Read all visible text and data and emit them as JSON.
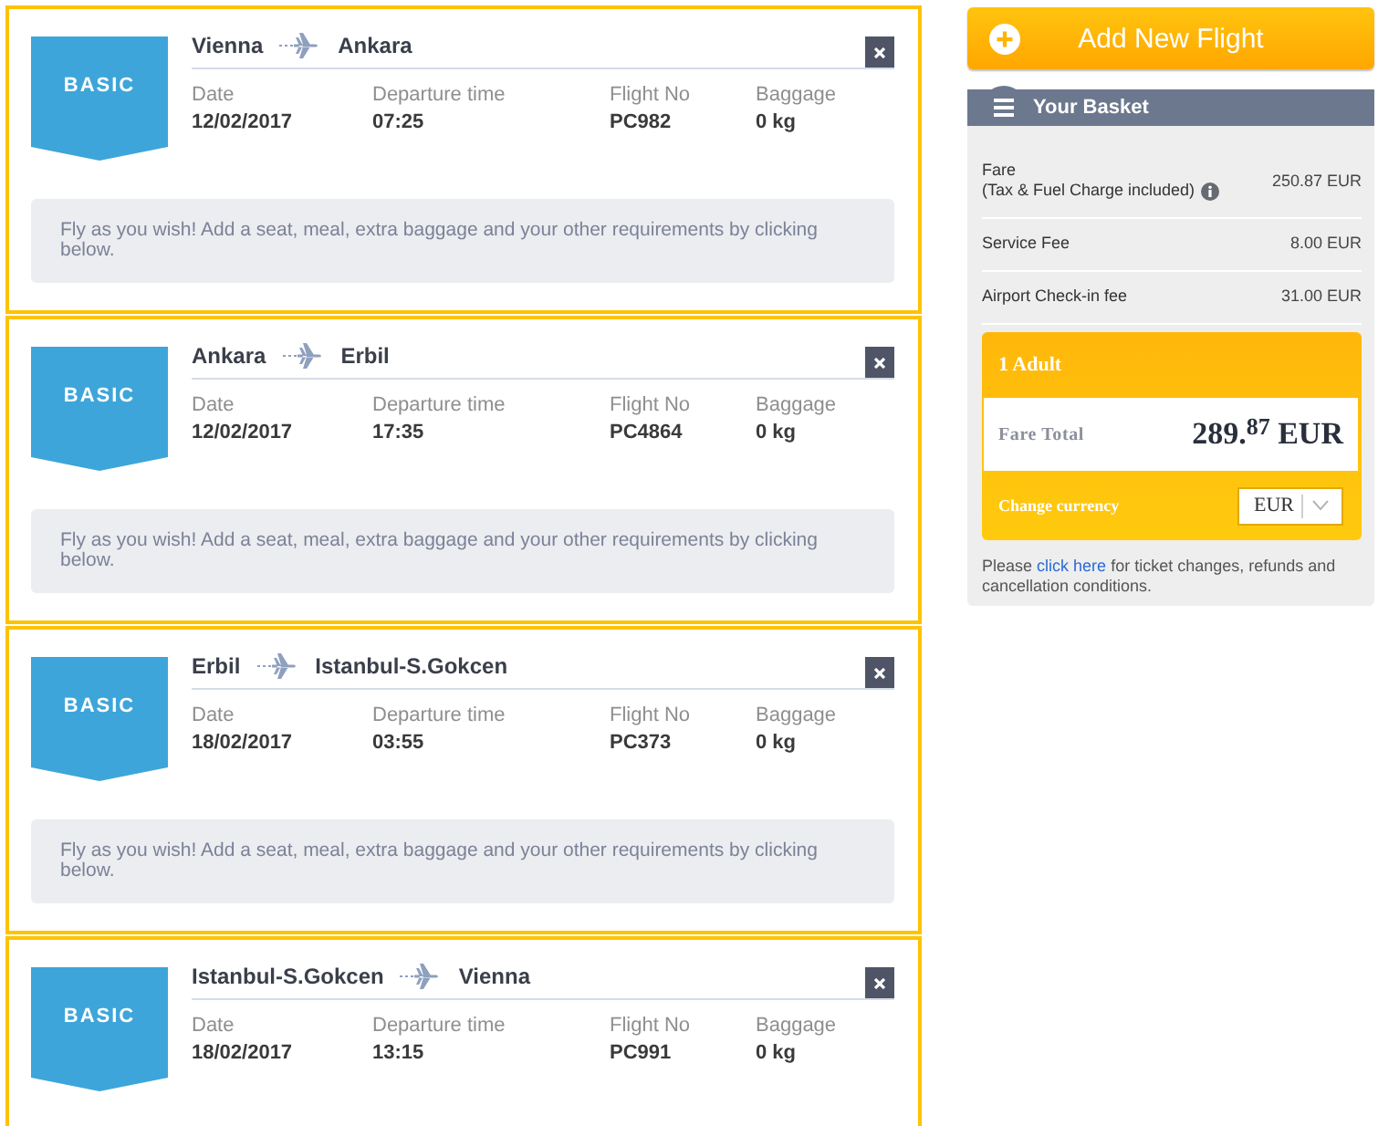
{
  "flights": [
    {
      "fare_type": "BASIC",
      "origin": "Vienna",
      "destination": "Ankara",
      "details": [
        {
          "label": "Date",
          "value": "12/02/2017"
        },
        {
          "label": "Departure time",
          "value": "07:25"
        },
        {
          "label": "Flight No",
          "value": "PC982"
        },
        {
          "label": "Baggage",
          "value": "0 kg"
        }
      ],
      "info": "Fly as you wish! Add a seat, meal, extra baggage and your other requirements by clicking below."
    },
    {
      "fare_type": "BASIC",
      "origin": "Ankara",
      "destination": "Erbil",
      "details": [
        {
          "label": "Date",
          "value": "12/02/2017"
        },
        {
          "label": "Departure time",
          "value": "17:35"
        },
        {
          "label": "Flight No",
          "value": "PC4864"
        },
        {
          "label": "Baggage",
          "value": "0 kg"
        }
      ],
      "info": "Fly as you wish! Add a seat, meal, extra baggage and your other requirements by clicking below."
    },
    {
      "fare_type": "BASIC",
      "origin": "Erbil",
      "destination": "Istanbul-S.Gokcen",
      "details": [
        {
          "label": "Date",
          "value": "18/02/2017"
        },
        {
          "label": "Departure time",
          "value": "03:55"
        },
        {
          "label": "Flight No",
          "value": "PC373"
        },
        {
          "label": "Baggage",
          "value": "0 kg"
        }
      ],
      "info": "Fly as you wish! Add a seat, meal, extra baggage and your other requirements by clicking below."
    },
    {
      "fare_type": "BASIC",
      "origin": "Istanbul-S.Gokcen",
      "destination": "Vienna",
      "details": [
        {
          "label": "Date",
          "value": "18/02/2017"
        },
        {
          "label": "Departure time",
          "value": "13:15"
        },
        {
          "label": "Flight No",
          "value": "PC991"
        },
        {
          "label": "Baggage",
          "value": "0 kg"
        }
      ]
    }
  ],
  "add_flight_button": "Add New Flight",
  "basket": {
    "title": "Your Basket",
    "fees": [
      {
        "label": "Fare",
        "note": "(Tax & Fuel Charge included)",
        "info_icon": true,
        "amount": "250.87 EUR"
      },
      {
        "label": "Service Fee",
        "info_icon": false,
        "amount": "8.00 EUR"
      },
      {
        "label": "Airport Check-in fee",
        "info_icon": false,
        "amount": "31.00 EUR"
      }
    ],
    "summary": {
      "passengers": "1 Adult",
      "total_label": "Fare Total",
      "total": "289.$^{87}$ EUR",
      "currency_label": "Change currency",
      "currency_select": "EUR"
    },
    "footer": {
      "before": "Please",
      "link": "click here",
      "after": "for ticket changes, refunds and cancellation conditions."
    }
  }
}
